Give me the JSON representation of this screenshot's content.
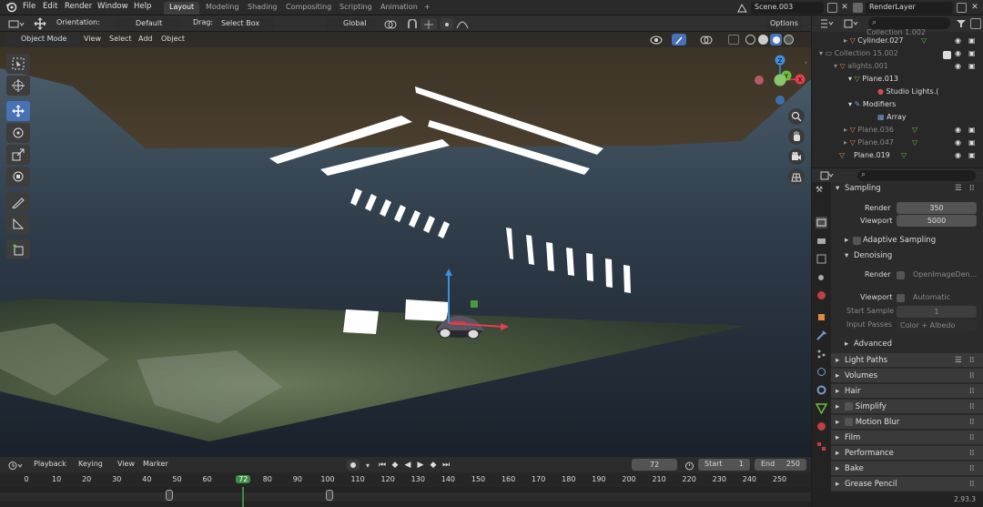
{
  "menubar": {
    "items": [
      "File",
      "Edit",
      "Render",
      "Window",
      "Help"
    ],
    "workspaces": [
      "Layout",
      "Modeling",
      "Shading",
      "Compositing",
      "Scripting",
      "Animation"
    ],
    "add_tab": "+",
    "scene": "Scene.003",
    "view_layer": "RenderLayer"
  },
  "viewport_header": {
    "orientation_label": "Orientation:",
    "orientation_value": "Default",
    "drag_label": "Drag:",
    "drag_value": "Select Box",
    "transform_value": "Global",
    "options_label": "Options"
  },
  "viewport_header2": {
    "mode": "Object Mode",
    "menus": [
      "View",
      "Select",
      "Add",
      "Object"
    ]
  },
  "gizmo": {
    "x_label": "X",
    "y_label": "Y",
    "z_label": "Z"
  },
  "outliner": {
    "rows": [
      {
        "label": "Collection 1.002",
        "dim": true
      },
      {
        "label": "Cylinder.027",
        "dim": false
      },
      {
        "label": "Collection 15.002",
        "dim": true
      },
      {
        "label": "alights.001",
        "dim": true
      },
      {
        "label": "Plane.013",
        "dim": false
      },
      {
        "label": "Studio Lights.(",
        "dim": false
      },
      {
        "label": "Modifiers",
        "dim": false
      },
      {
        "label": "Array",
        "dim": false
      },
      {
        "label": "Plane.036",
        "dim": true
      },
      {
        "label": "Plane.047",
        "dim": true
      },
      {
        "label": "Plane.019",
        "dim": false
      }
    ]
  },
  "properties": {
    "sampling_title": "Sampling",
    "render_label": "Render",
    "render_value": "350",
    "viewport_label": "Viewport",
    "viewport_value": "5000",
    "adaptive_label": "Adaptive Sampling",
    "denoising_title": "Denoising",
    "den_render_label": "Render",
    "den_render_value": "OpenImageDen...",
    "den_viewport_label": "Viewport",
    "den_viewport_value": "Automatic",
    "start_sample_label": "Start Sample",
    "start_sample_value": "1",
    "input_passes_label": "Input Passes",
    "input_passes_value": "Color + Albedo",
    "advanced_label": "Advanced",
    "sections": [
      "Light Paths",
      "Volumes",
      "Hair",
      "Simplify",
      "Motion Blur",
      "Film",
      "Performance",
      "Bake",
      "Grease Pencil"
    ]
  },
  "timeline": {
    "menus": [
      "Playback",
      "Keying",
      "View",
      "Marker"
    ],
    "current_frame": "72",
    "start_label": "Start",
    "start_value": "1",
    "end_label": "End",
    "end_value": "250",
    "ruler": [
      "0",
      "10",
      "20",
      "30",
      "40",
      "50",
      "60",
      "72",
      "80",
      "90",
      "100",
      "110",
      "120",
      "130",
      "140",
      "150",
      "160",
      "170",
      "180",
      "190",
      "200",
      "210",
      "220",
      "230",
      "240",
      "250"
    ]
  },
  "version": "2.93.3",
  "colors": {
    "accent": "#4772b3",
    "frame_marker": "#3e8e41",
    "header": "#303030",
    "panel": "#2b2b2b"
  }
}
